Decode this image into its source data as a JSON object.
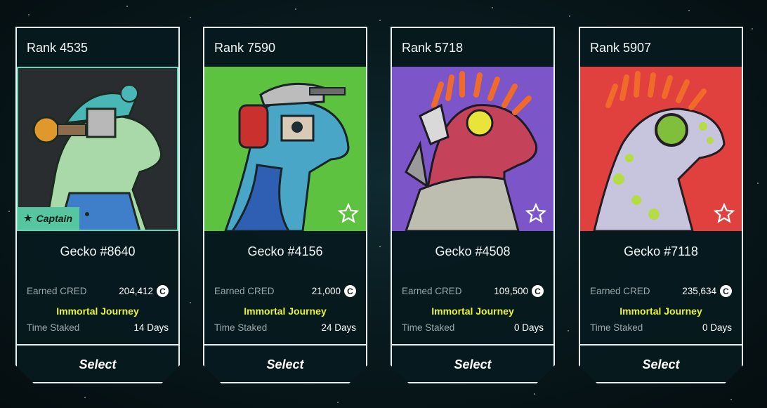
{
  "cards": [
    {
      "rank": "Rank 4535",
      "name": "Gecko #8640",
      "earned_label": "Earned CRED",
      "earned_value": "204,412",
      "cred_symbol": "C",
      "journey": "Immortal Journey",
      "time_label": "Time Staked",
      "time_value": "14 Days",
      "badge": "Captain",
      "select_label": "Select",
      "bg_color": "#2a2d30"
    },
    {
      "rank": "Rank 7590",
      "name": "Gecko #4156",
      "earned_label": "Earned CRED",
      "earned_value": "21,000",
      "cred_symbol": "C",
      "journey": "Immortal Journey",
      "time_label": "Time Staked",
      "time_value": "24 Days",
      "select_label": "Select",
      "bg_color": "#5cc23f"
    },
    {
      "rank": "Rank 5718",
      "name": "Gecko #4508",
      "earned_label": "Earned CRED",
      "earned_value": "109,500",
      "cred_symbol": "C",
      "journey": "Immortal Journey",
      "time_label": "Time Staked",
      "time_value": "0 Days",
      "select_label": "Select",
      "bg_color": "#7c55c8"
    },
    {
      "rank": "Rank 5907",
      "name": "Gecko #7118",
      "earned_label": "Earned CRED",
      "earned_value": "235,634",
      "cred_symbol": "C",
      "journey": "Immortal Journey",
      "time_label": "Time Staked",
      "time_value": "0 Days",
      "select_label": "Select",
      "bg_color": "#e0403e"
    }
  ],
  "colors": {
    "accent_journey": "#e9f33a",
    "captain_badge": "#56c6a0",
    "border": "#e8f2f2"
  }
}
